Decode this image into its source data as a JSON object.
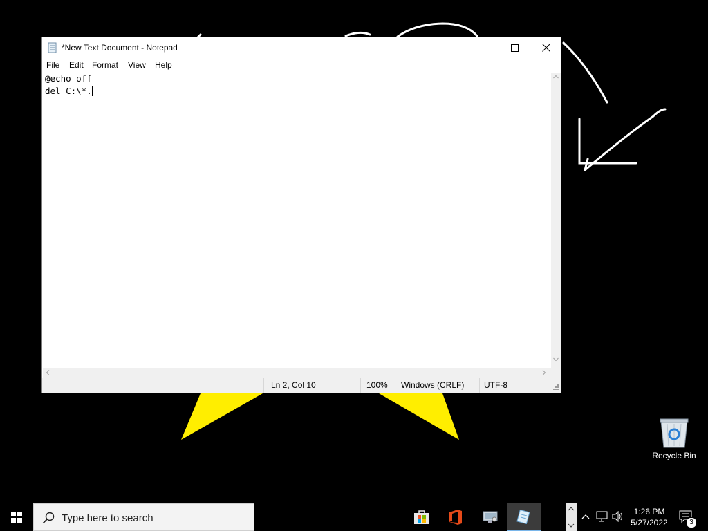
{
  "notepad": {
    "title": "*New Text Document - Notepad",
    "menu": {
      "file": "File",
      "edit": "Edit",
      "format": "Format",
      "view": "View",
      "help": "Help"
    },
    "editor_lines": [
      "@echo off",
      "del C:\\*."
    ],
    "status": {
      "position": "Ln 2, Col 10",
      "zoom": "100%",
      "line_ending": "Windows (CRLF)",
      "encoding": "UTF-8"
    }
  },
  "desktop": {
    "recycle_bin_label": "Recycle Bin"
  },
  "taskbar": {
    "search_placeholder": "Type here to search",
    "clock_time": "1:26 PM",
    "clock_date": "5/27/2022",
    "notification_count": "3",
    "pinned_apps": [
      "store-icon",
      "office-icon",
      "control-panel-icon",
      "notepad-icon"
    ]
  },
  "colors": {
    "accent": "#7ab6ea",
    "star_yellow": "#ffee00",
    "desktop_background": "#000000"
  }
}
